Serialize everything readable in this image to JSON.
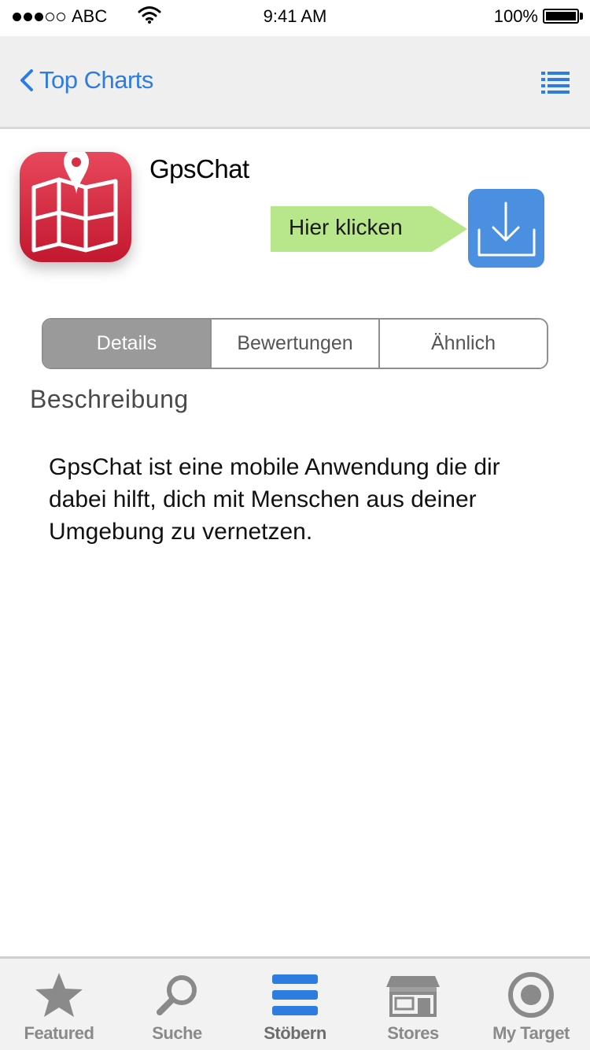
{
  "status_bar": {
    "carrier": "ABC",
    "time": "9:41 AM",
    "battery_percent": "100%",
    "signal_bars_filled": 3,
    "signal_bars_total": 5
  },
  "nav": {
    "back_label": "Top Charts",
    "back_icon": "chevron-left-icon",
    "menu_icon": "list-icon",
    "accent_color": "#2e7ce0"
  },
  "app": {
    "name": "GpsChat",
    "icon": "map-pin-icon",
    "hint_label": "Hier klicken",
    "download_icon": "download-icon"
  },
  "segments": [
    {
      "label": "Details",
      "active": true
    },
    {
      "label": "Bewertungen",
      "active": false
    },
    {
      "label": "Ähnlich",
      "active": false
    }
  ],
  "description": {
    "title": "Beschreibung",
    "text": "GpsChat ist eine mobile Anwendung die dir dabei hilft, dich mit Menschen aus deiner Umgebung zu vernetzen."
  },
  "tabs": [
    {
      "label": "Featured",
      "icon": "star-icon"
    },
    {
      "label": "Suche",
      "icon": "search-icon"
    },
    {
      "label": "Stöbern",
      "icon": "list-icon",
      "active": true
    },
    {
      "label": "Stores",
      "icon": "store-icon"
    },
    {
      "label": "My Target",
      "icon": "target-icon"
    }
  ]
}
